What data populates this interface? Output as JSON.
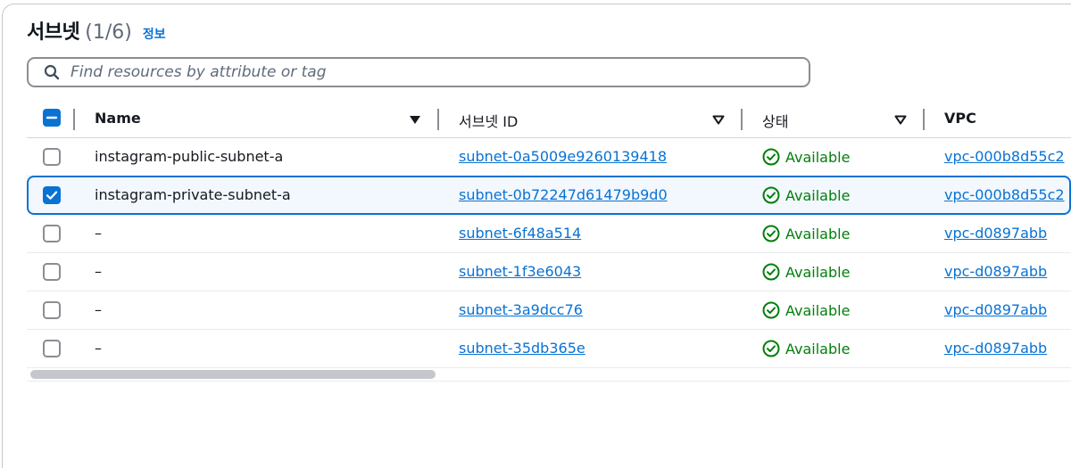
{
  "header": {
    "title": "서브넷",
    "count": "(1/6)",
    "info_link": "정보"
  },
  "search": {
    "placeholder": "Find resources by attribute or tag",
    "value": ""
  },
  "columns": {
    "name": "Name",
    "subnet_id": "서브넷 ID",
    "state": "상태",
    "vpc": "VPC"
  },
  "rows": [
    {
      "selected": false,
      "name": "instagram-public-subnet-a",
      "subnet_id": "subnet-0a5009e9260139418",
      "state": "Available",
      "vpc": "vpc-000b8d55c2"
    },
    {
      "selected": true,
      "name": "instagram-private-subnet-a",
      "subnet_id": "subnet-0b72247d61479b9d0",
      "state": "Available",
      "vpc": "vpc-000b8d55c2"
    },
    {
      "selected": false,
      "name": "–",
      "subnet_id": "subnet-6f48a514",
      "state": "Available",
      "vpc": "vpc-d0897abb"
    },
    {
      "selected": false,
      "name": "–",
      "subnet_id": "subnet-1f3e6043",
      "state": "Available",
      "vpc": "vpc-d0897abb"
    },
    {
      "selected": false,
      "name": "–",
      "subnet_id": "subnet-3a9dcc76",
      "state": "Available",
      "vpc": "vpc-d0897abb"
    },
    {
      "selected": false,
      "name": "–",
      "subnet_id": "subnet-35db365e",
      "state": "Available",
      "vpc": "vpc-d0897abb"
    }
  ],
  "colors": {
    "link": "#0972d3",
    "success": "#037f0c",
    "selected_border": "#0972d3"
  },
  "icons": {
    "search": "search-icon",
    "status": "check-circle-icon",
    "sort_active": "caret-down-filled-icon",
    "sort": "caret-down-outline-icon"
  }
}
